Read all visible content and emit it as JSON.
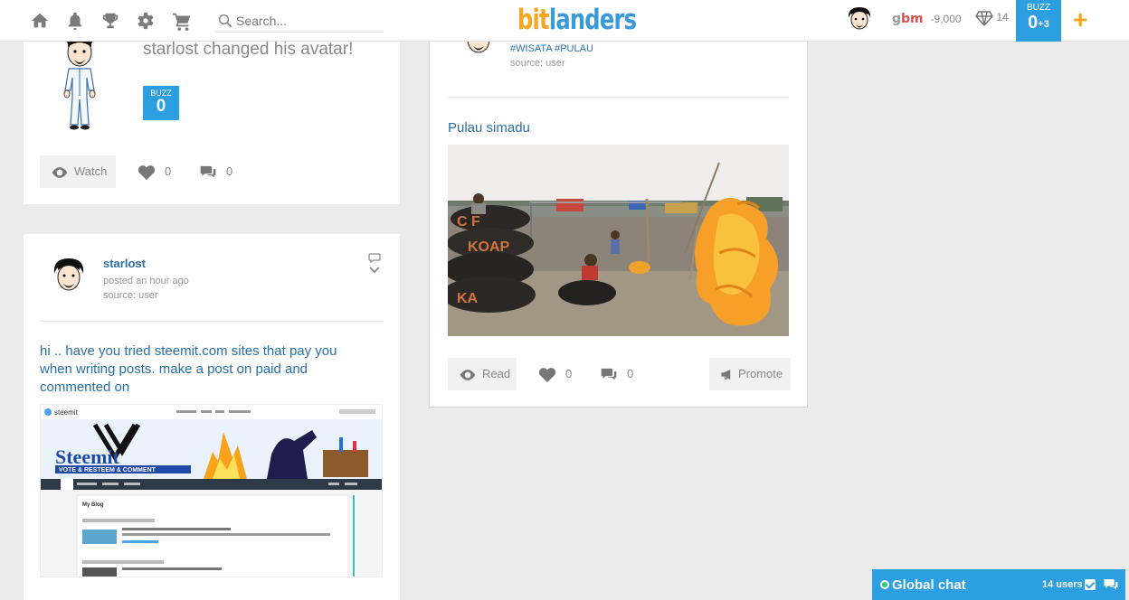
{
  "header": {
    "nav_icons": [
      "home-icon",
      "bell-icon",
      "trophy-icon",
      "gear-icon",
      "cart-icon"
    ],
    "search_placeholder": "Search...",
    "logo_part1": "bit",
    "logo_part2": "landers",
    "gbm_g": "g",
    "gbm_bm": "bm",
    "gbm_value": "-9,000",
    "gems_count": "14",
    "buzz_label": "BUZZ",
    "buzz_value": "0",
    "buzz_delta": "+3",
    "add_label": "+"
  },
  "card1": {
    "activity_text": "starlost changed his avatar!",
    "buzz_label": "BUZZ",
    "buzz_value": "0",
    "watch_label": "Watch",
    "likes": "0",
    "comments": "0"
  },
  "card2": {
    "author": "starlost",
    "posted": "posted an hour ago",
    "source": "source: user",
    "text": "hi .. have you tried steemit.com sites that pay you when writing posts. make a post on paid and commented on",
    "image": {
      "site": "steemit",
      "banner_title": "Steemit",
      "banner_subtitle": "VOTE & RESTEEM & COMMENT",
      "blog_title": "My Blog"
    }
  },
  "card3": {
    "hashtags": "#WISATA #PULAU",
    "source": "source: user",
    "title": "Pulau simadu",
    "read_label": "Read",
    "likes": "0",
    "comments": "0",
    "promote_label": "Promote"
  },
  "chat": {
    "title": "Global chat",
    "users": "14 users"
  },
  "colors": {
    "accent_blue": "#2c9fe0",
    "link_blue": "#2a6fa8",
    "logo_orange": "#f5a623"
  }
}
